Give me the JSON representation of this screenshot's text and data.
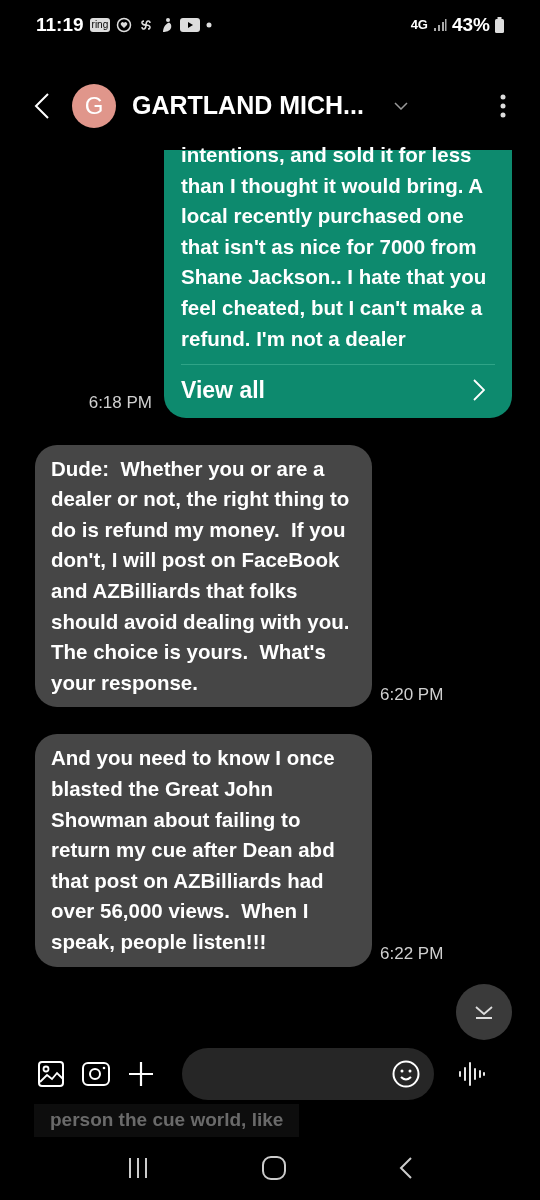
{
  "status_bar": {
    "time": "11:19",
    "ring_badge": "ring",
    "network": "4G",
    "battery_text": "43%"
  },
  "header": {
    "avatar_letter": "G",
    "title": "GARTLAND MICH..."
  },
  "messages": [
    {
      "kind": "sent",
      "text": "intentions, and sold it for less than I thought it would bring. A local recently purchased one that isn't as nice for 7000 from Shane Jackson.. I hate that you feel cheated, but I can't make a refund. I'm not a dealer",
      "view_all": "View all",
      "time": "6:18 PM"
    },
    {
      "kind": "received",
      "text": "Dude:  Whether you or are a dealer or not, the right thing to do is refund my money.  If you don't, I will post on FaceBook and AZBilliards that folks should avoid dealing with you.  The choice is yours.  What's your response.",
      "time": "6:20 PM"
    },
    {
      "kind": "received",
      "text": "And you need to know I once blasted the Great John Showman about failing to return my cue after Dean abd that post on AZBilliards had over 56,000 views.  When I speak, people listen!!!",
      "time": "6:22 PM"
    }
  ],
  "ghost_text": "person the cue world, like"
}
